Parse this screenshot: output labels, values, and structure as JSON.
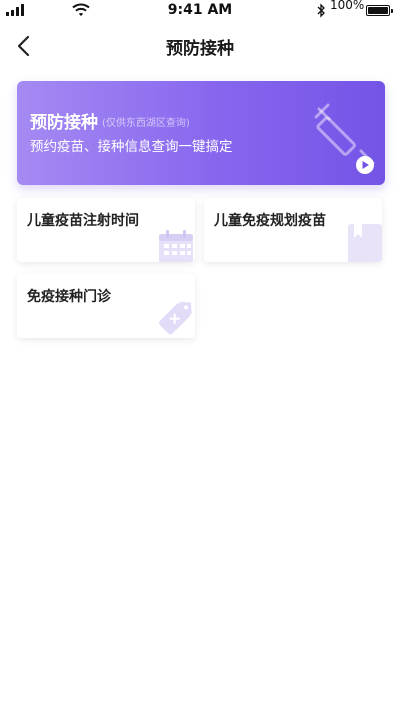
{
  "status_bar": {
    "time": "9:41 AM",
    "battery_percent": "100%"
  },
  "nav": {
    "title": "预防接种"
  },
  "banner": {
    "title": "预防接种",
    "note": "(仅供东西湖区查询)",
    "subtitle": "预约疫苗、接种信息查询一键搞定",
    "gradient_colors": [
      "#a58af3",
      "#7454e6"
    ]
  },
  "cards": [
    {
      "label": "儿童疫苗注射时间",
      "icon": "calendar-icon"
    },
    {
      "label": "儿童免疫规划疫苗",
      "icon": "bookmark-book-icon"
    },
    {
      "label": "免疫接种门诊",
      "icon": "medicine-tag-icon"
    }
  ]
}
